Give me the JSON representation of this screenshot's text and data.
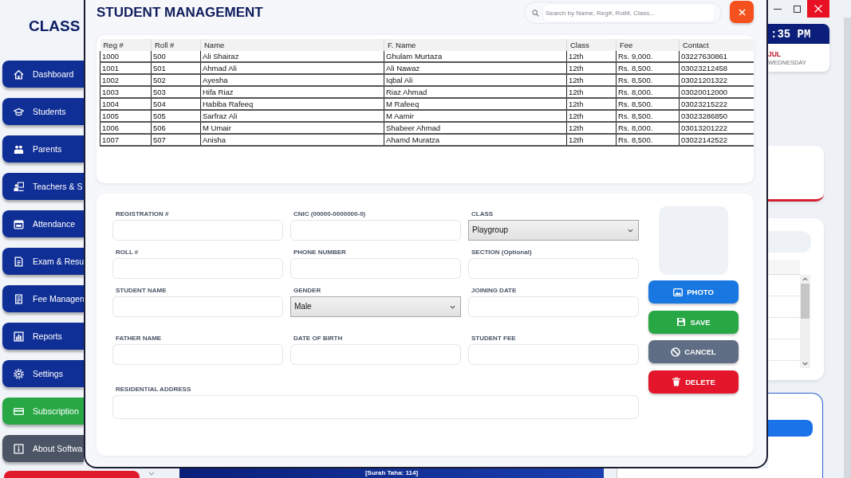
{
  "sidebar": {
    "logo": "CLASS",
    "items": [
      {
        "label": "Dashboard",
        "color": "#102f96"
      },
      {
        "label": "Students",
        "color": "#102f96"
      },
      {
        "label": "Parents",
        "color": "#102f96"
      },
      {
        "label": "Teachers & S",
        "color": "#102f96"
      },
      {
        "label": "Attendance",
        "color": "#102f96"
      },
      {
        "label": "Exam & Resu",
        "color": "#102f96"
      },
      {
        "label": "Fee Managen",
        "color": "#102f96"
      },
      {
        "label": "Reports",
        "color": "#102f96"
      },
      {
        "label": "Settings",
        "color": "#102f96"
      },
      {
        "label": "Subscription",
        "color": "#28a745"
      },
      {
        "label": "About Softwa",
        "color": "#4b5565"
      }
    ]
  },
  "dialog": {
    "title": "STUDENT MANAGEMENT",
    "search": {
      "placeholder": "Search by Name, Reg#, Roll#, Class..."
    },
    "table": {
      "columns": [
        "Reg #",
        "Roll #",
        "Name",
        "F. Name",
        "Class",
        "Fee",
        "Contact"
      ],
      "rows": [
        [
          "1000",
          "500",
          "Ali Shairaz",
          "Ghulam Murtaza",
          "12th",
          "Rs. 9,000.",
          "03227630861"
        ],
        [
          "1001",
          "501",
          "Ahmad Ali",
          "Ali Nawaz",
          "12th",
          "Rs. 8,500.",
          "03023212458"
        ],
        [
          "1002",
          "502",
          "Ayesha",
          "Iqbal Ali",
          "12th",
          "Rs. 8,500.",
          "03021201322"
        ],
        [
          "1003",
          "503",
          "Hifa Riaz",
          "Riaz Ahmad",
          "12th",
          "Rs. 8,000.",
          "03020012000"
        ],
        [
          "1004",
          "504",
          "Habiba Rafeeq",
          "M Rafeeq",
          "12th",
          "Rs. 8,500.",
          "03023215222"
        ],
        [
          "1005",
          "505",
          "Sarfraz Ali",
          "M Aamir",
          "12th",
          "Rs. 8,500.",
          "03023286850"
        ],
        [
          "1006",
          "506",
          "M Umair",
          "Shabeer Ahmad",
          "12th",
          "Rs. 8,000.",
          "03013201222"
        ],
        [
          "1007",
          "507",
          "Anisha",
          "Ahamd Muratza",
          "12th",
          "Rs. 8,500.",
          "03022142522"
        ]
      ]
    },
    "form": {
      "fields": [
        {
          "label": "REGISTRATION #",
          "kind": "text"
        },
        {
          "label": "CNIC (00000-0000000-0)",
          "kind": "text"
        },
        {
          "label": "CLASS",
          "kind": "select",
          "value": "Playgroup"
        },
        {
          "label": "ROLL #",
          "kind": "text"
        },
        {
          "label": "PHONE NUMBER",
          "kind": "text"
        },
        {
          "label": "SECTION (Optional)",
          "kind": "text"
        },
        {
          "label": "STUDENT NAME",
          "kind": "text"
        },
        {
          "label": "GENDER",
          "kind": "select",
          "value": "Male"
        },
        {
          "label": "JOINING DATE",
          "kind": "text"
        },
        {
          "label": "FATHER NAME",
          "kind": "text"
        },
        {
          "label": "DATE OF BIRTH",
          "kind": "text"
        },
        {
          "label": "STUDENT FEE",
          "kind": "text"
        },
        {
          "label": "RESIDENTIAL ADDRESS",
          "kind": "wide"
        }
      ],
      "buttons": [
        {
          "label": "PHOTO",
          "color": "#1877e0"
        },
        {
          "label": "SAVE",
          "color": "#28a745"
        },
        {
          "label": "CANCEL",
          "color": "#5f6e85"
        },
        {
          "label": "DELETE",
          "color": "#e3162b"
        }
      ]
    }
  },
  "clock": {
    "time": ":35 PM",
    "month": "JUL",
    "weekday": "WEDNESDAY"
  },
  "footer": {
    "verse": "[Surah Taha: 114]"
  }
}
